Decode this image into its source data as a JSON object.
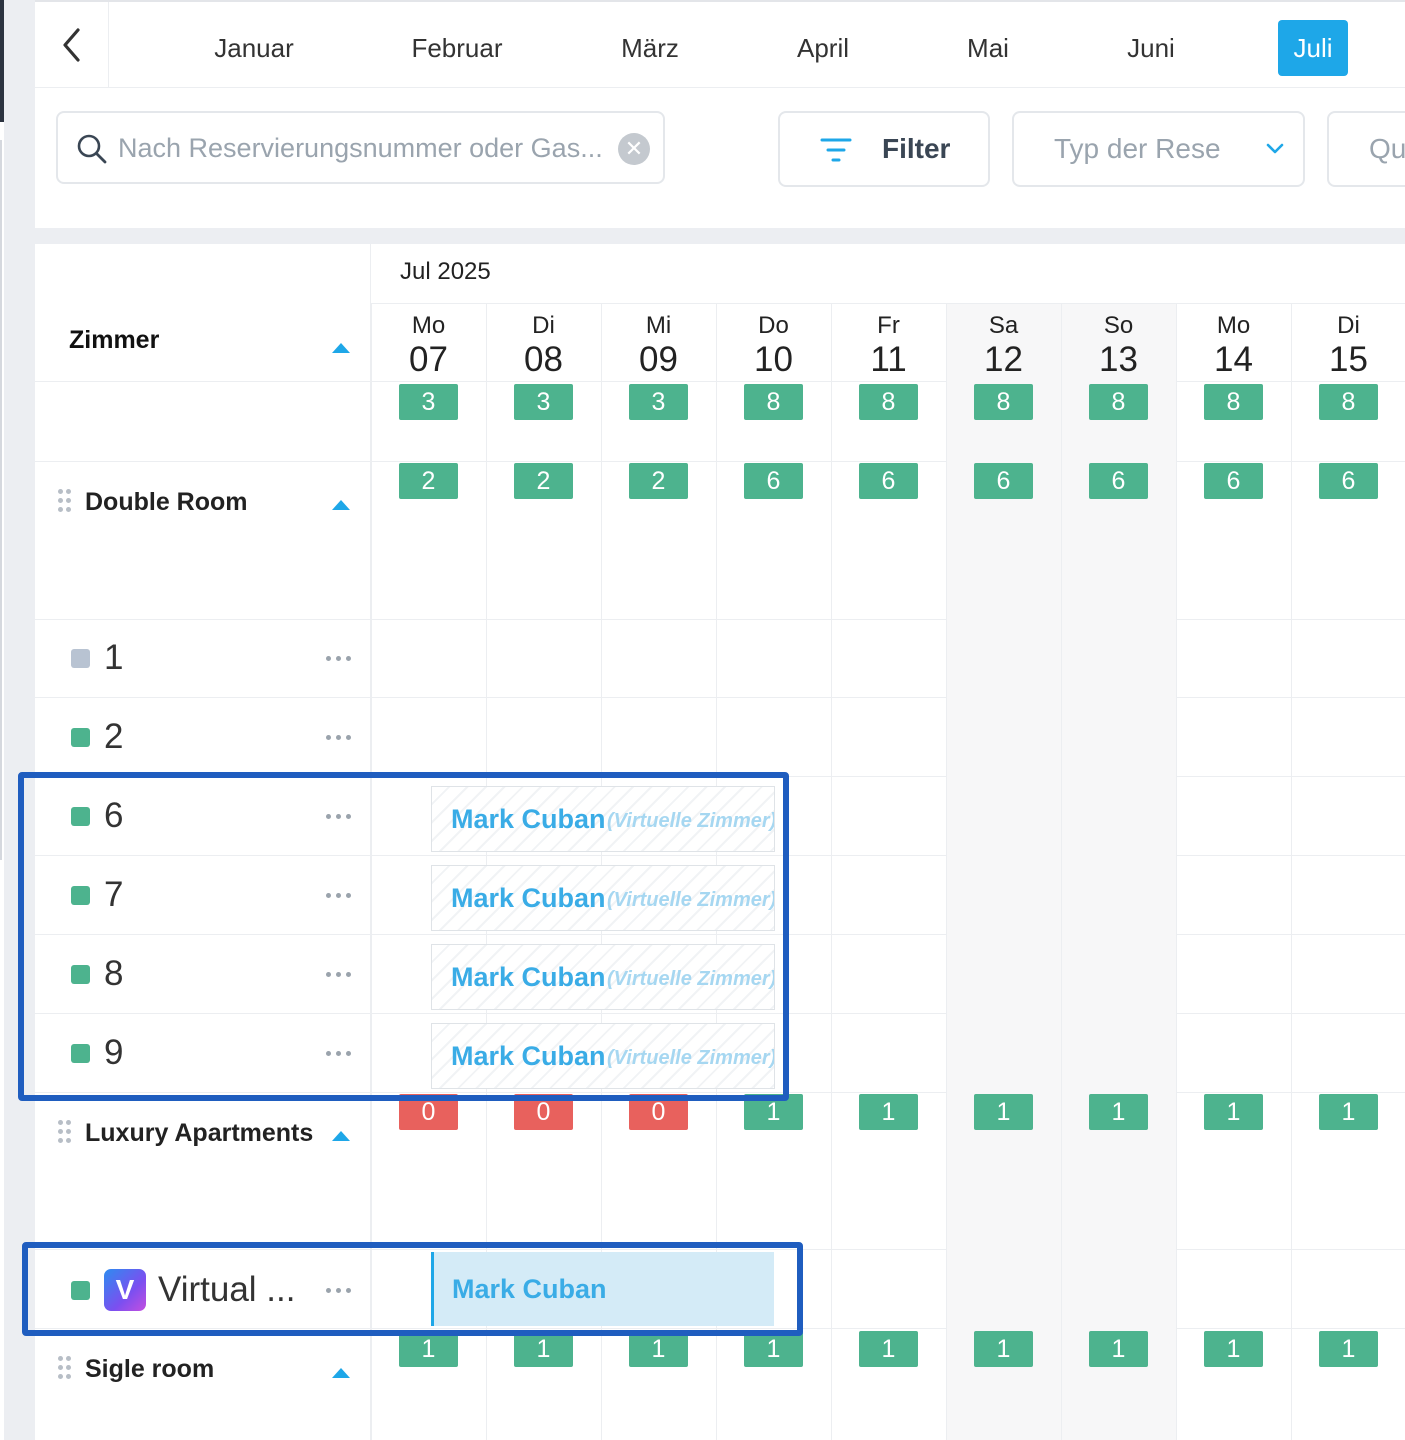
{
  "months": [
    "Januar",
    "Februar",
    "März",
    "April",
    "Mai",
    "Juni",
    "Juli"
  ],
  "active_month": "Juli",
  "search": {
    "placeholder": "Nach Reservierungsnummer oder Gas..."
  },
  "toolbar": {
    "filter_label": "Filter",
    "type_placeholder": "Typ der Rese",
    "quick_placeholder": "Qu"
  },
  "calendar": {
    "month_label": "Jul 2025",
    "rooms_header": "Zimmer",
    "days": [
      {
        "name": "Mo",
        "num": "07"
      },
      {
        "name": "Di",
        "num": "08"
      },
      {
        "name": "Mi",
        "num": "09"
      },
      {
        "name": "Do",
        "num": "10"
      },
      {
        "name": "Fr",
        "num": "11"
      },
      {
        "name": "Sa",
        "num": "12"
      },
      {
        "name": "So",
        "num": "13"
      },
      {
        "name": "Mo",
        "num": "14"
      },
      {
        "name": "Di",
        "num": "15"
      }
    ],
    "total_availability": [
      "3",
      "3",
      "3",
      "8",
      "8",
      "8",
      "8",
      "8",
      "8"
    ],
    "groups": [
      {
        "name": "Double Room",
        "availability": [
          "2",
          "2",
          "2",
          "6",
          "6",
          "6",
          "6",
          "6",
          "6"
        ],
        "rooms": [
          "1",
          "2",
          "6",
          "7",
          "8",
          "9"
        ]
      },
      {
        "name": "Luxury Apartments",
        "availability": [
          "0",
          "0",
          "0",
          "1",
          "1",
          "1",
          "1",
          "1",
          "1"
        ],
        "rooms": [
          "Virtual ..."
        ]
      },
      {
        "name": "Sigle room",
        "availability": [
          "1",
          "1",
          "1",
          "1",
          "1",
          "1",
          "1",
          "1",
          "1"
        ],
        "rooms": []
      }
    ],
    "bookings": [
      {
        "guest": "Mark Cuban",
        "tag": "(Virtuelle Zimmer)"
      },
      {
        "guest": "Mark Cuban",
        "tag": "(Virtuelle Zimmer)"
      },
      {
        "guest": "Mark Cuban",
        "tag": "(Virtuelle Zimmer)"
      },
      {
        "guest": "Mark Cuban",
        "tag": "(Virtuelle Zimmer)"
      }
    ],
    "virtual_booking": {
      "guest": "Mark Cuban"
    },
    "virtual_icon_letter": "V"
  },
  "colors": {
    "accent": "#1ea7e8",
    "available": "#4db38e",
    "unavailable": "#e8615d",
    "highlight": "#1f5dbf"
  }
}
